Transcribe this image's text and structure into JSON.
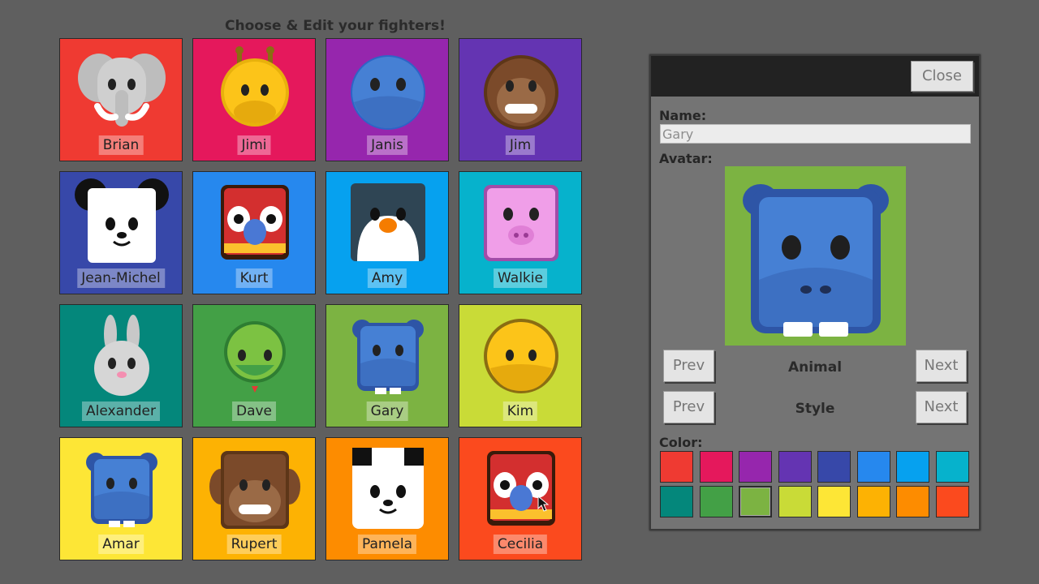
{
  "title": "Choose & Edit your fighters!",
  "fighters": [
    {
      "name": "Brian",
      "bg": "#ef3a32",
      "animal": "elephant"
    },
    {
      "name": "Jimi",
      "bg": "#e5185c",
      "animal": "giraffe"
    },
    {
      "name": "Janis",
      "bg": "#9626ad",
      "animal": "hippo-round"
    },
    {
      "name": "Jim",
      "bg": "#6434b2",
      "animal": "monkey-round"
    },
    {
      "name": "Jean-Michel",
      "bg": "#3748a9",
      "animal": "panda-square"
    },
    {
      "name": "Kurt",
      "bg": "#2688ee",
      "animal": "parrot"
    },
    {
      "name": "Amy",
      "bg": "#06a1ef",
      "animal": "penguin"
    },
    {
      "name": "Walkie",
      "bg": "#06b2cc",
      "animal": "pig"
    },
    {
      "name": "Alexander",
      "bg": "#04877b",
      "animal": "rabbit"
    },
    {
      "name": "Dave",
      "bg": "#43a046",
      "animal": "snake"
    },
    {
      "name": "Gary",
      "bg": "#7cb342",
      "animal": "hippo-square"
    },
    {
      "name": "Kim",
      "bg": "#c9db37",
      "animal": "giraffe-round"
    },
    {
      "name": "Amar",
      "bg": "#fde636",
      "animal": "hippo-square"
    },
    {
      "name": "Rupert",
      "bg": "#fdb203",
      "animal": "monkey-square"
    },
    {
      "name": "Pamela",
      "bg": "#fd8c00",
      "animal": "panda-square2"
    },
    {
      "name": "Cecilia",
      "bg": "#fb4a1e",
      "animal": "parrot"
    }
  ],
  "editor": {
    "close_label": "Close",
    "name_label": "Name:",
    "name_value": "Gary",
    "avatar_label": "Avatar:",
    "animal_label": "Animal",
    "style_label": "Style",
    "prev_label": "Prev",
    "next_label": "Next",
    "color_label": "Color:",
    "avatar_bg": "#7cb342",
    "colors": [
      "#ef3a32",
      "#e5185c",
      "#9626ad",
      "#6434b2",
      "#3748a9",
      "#2688ee",
      "#06a1ef",
      "#06b2cc",
      "#04877b",
      "#43a046",
      "#7cb342",
      "#c9db37",
      "#fde636",
      "#fdb203",
      "#fd8c00",
      "#fb4a1e"
    ],
    "selected_color_index": 10
  }
}
